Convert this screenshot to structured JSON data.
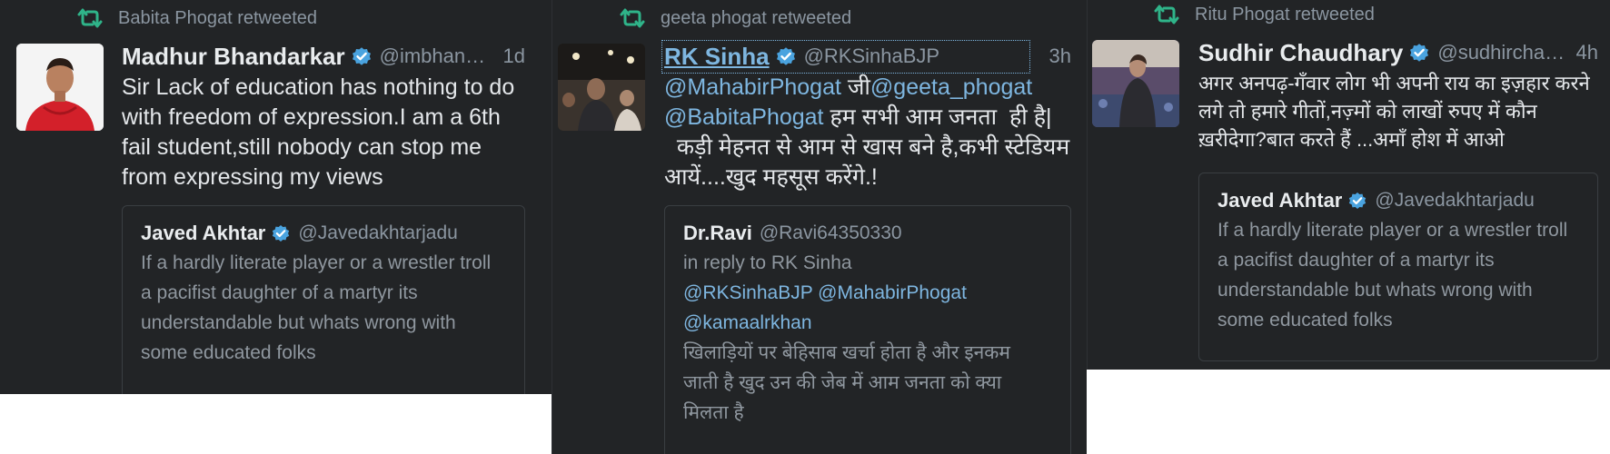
{
  "colors": {
    "background": "#222426",
    "retweet_green": "#2fb489",
    "link_blue": "#7eb6e0",
    "verified_blue": "#4aa3df",
    "muted_text": "#8b96a1"
  },
  "icons": {
    "retweet": "retweet-icon",
    "verified": "verified-badge-icon"
  },
  "columns": [
    {
      "retweeted_by": "Babita Phogat retweeted",
      "author_name": "Madhur Bhandarkar",
      "author_handle": "@imbhand…",
      "time": "1d",
      "text": "Sir Lack of education has nothing to do with freedom of expression.I am a 6th fail student,still nobody can stop me from expressing my views",
      "quote": {
        "name": "Javed Akhtar",
        "handle": "@Javedakhtarjadu",
        "text": "If a hardly literate player or a wrestler troll a pacifist daughter of a martyr its understandable but whats wrong with some educated folks"
      }
    },
    {
      "retweeted_by": "geeta phogat retweeted",
      "author_name": "RK Sinha",
      "author_handle": "@RKSinhaBJP",
      "time": "3h",
      "mention_1": "@MahabirPhogat",
      "text_ji": " जी",
      "mention_2": "@geeta_phogat",
      "mention_3": "@BabitaPhogat",
      "text_rest": " हम सभी आम जनता  ही है|\n  कड़ी मेहनत से आम से खास बने है,कभी स्टेडियम आयें....खुद महसूस करेंगे.!",
      "quote": {
        "name": "Dr.Ravi",
        "handle": "@Ravi64350330",
        "reply_to": "in reply to RK Sinha",
        "mentions": "@RKSinhaBJP @MahabirPhogat @kamaalrkhan",
        "text": "खिलाड़ियों पर बेहिसाब खर्चा होता है और इनकम जाती है खुद उन की जेब में आम जनता को क्या मिलता है"
      }
    },
    {
      "retweeted_by": "Ritu Phogat retweeted",
      "author_name": "Sudhir Chaudhary",
      "author_handle": "@sudhircha…",
      "time": "4h",
      "text": "अगर अनपढ़-गँवार लोग भी अपनी राय का इज़हार करने लगे तो हमारे गीतों,नज़्मों को लाखों रुपए में कौन ख़रीदेगा?बात करते हैं ...अमाँ होश में आओ",
      "quote": {
        "name": "Javed Akhtar",
        "handle": "@Javedakhtarjadu",
        "text": "If a hardly literate player or a wrestler troll a pacifist daughter of a martyr its understandable but whats wrong with some educated folks"
      }
    }
  ]
}
